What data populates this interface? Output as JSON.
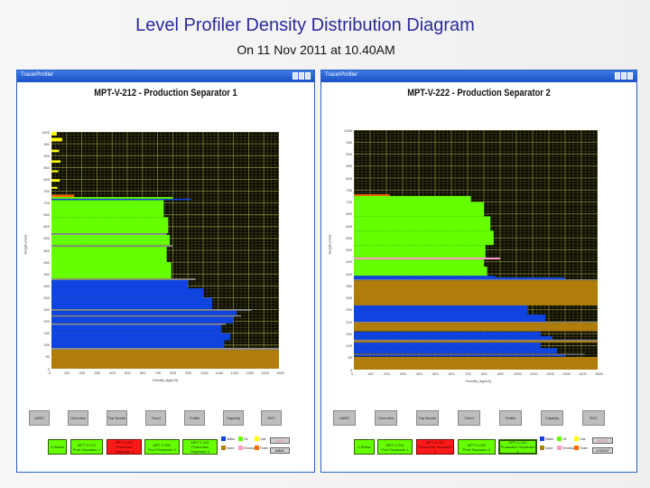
{
  "slide": {
    "title": "Level Profiler Density Distribution Diagram",
    "subtitle": "On 11 Nov 2011 at 10.40AM"
  },
  "phase_colors": {
    "water": "#1044e0",
    "oil": "#66ff00",
    "gas": "#ffff00",
    "sand": "#b07d0a",
    "emulsion": "#ff99cc",
    "foam": "#ff6a00",
    "interface": "#8c8c8c"
  },
  "windows": [
    {
      "app_title": "TracerProfiler",
      "nav_buttons": [
        "LMRC",
        "Overview",
        "Top Nozzle",
        "Trend",
        "Profile",
        "Capacity",
        "RZC"
      ],
      "vessel_buttons": [
        {
          "line1": "V-Status",
          "line2": "",
          "state": "ok"
        },
        {
          "line1": "MPT-V-212",
          "line2": "Prod Separator 1",
          "state": "ok"
        },
        {
          "line1": "MPT-V-222",
          "line2": "Production Separator 2",
          "state": "alarm"
        },
        {
          "line1": "MPT-V-232",
          "line2": "Prod Separator 3",
          "state": "ok"
        },
        {
          "line1": "MPT-V-242",
          "line2": "Production Separator 4",
          "state": "ok"
        }
      ],
      "legend": [
        "Water",
        "Oil",
        "Gas",
        "Sand",
        "Emulsion",
        "Foam"
      ],
      "alert_label": "ALERT",
      "action_label": "MIMIC"
    },
    {
      "app_title": "TracerProfiler",
      "nav_buttons": [
        "LMRC",
        "Overview",
        "Top Nozzle",
        "Trend",
        "Profile",
        "Capacity",
        "RZC"
      ],
      "vessel_buttons": [
        {
          "line1": "V-Status",
          "line2": "",
          "state": "ok"
        },
        {
          "line1": "MPT-V-212",
          "line2": "Prod Separator 1",
          "state": "ok"
        },
        {
          "line1": "MPT-V-222",
          "line2": "Production Separator 2",
          "state": "alarm"
        },
        {
          "line1": "MPT-V-232",
          "line2": "Prod Separator 3",
          "state": "ok"
        },
        {
          "line1": "MPT-V-242",
          "line2": "Production Separator 4",
          "state": "ok"
        }
      ],
      "legend": [
        "Water",
        "Oil",
        "Gas",
        "Sand",
        "Emulsion",
        "Foam"
      ],
      "alert_label": "ALERT",
      "action_label": "LOGOUT"
    }
  ],
  "chart_data": [
    {
      "type": "bar",
      "orientation": "horizontal",
      "title": "MPT-V-212 - Production Separator 1",
      "xlabel": "Density (kg/m3)",
      "ylabel": "Height (mm)",
      "xlim": [
        0,
        1500
      ],
      "ylim": [
        0,
        1000
      ],
      "xticks": [
        "0",
        "100",
        "200",
        "300",
        "400",
        "500",
        "600",
        "700",
        "800",
        "900",
        "1000",
        "1100",
        "1200",
        "1300",
        "1400",
        "1500"
      ],
      "yticks": [
        "0",
        "50",
        "100",
        "150",
        "200",
        "250",
        "300",
        "350",
        "400",
        "450",
        "500",
        "550",
        "600",
        "650",
        "700",
        "750",
        "800",
        "850",
        "900",
        "950",
        "1000"
      ],
      "grid": true,
      "bands": [
        {
          "y0": 0,
          "y1": 80,
          "phase": "sand",
          "density": 1500
        },
        {
          "y0": 80,
          "y1": 88,
          "phase": "interface",
          "density": 1500
        },
        {
          "y0": 88,
          "y1": 120,
          "phase": "water",
          "density": 1140
        },
        {
          "y0": 120,
          "y1": 150,
          "phase": "water",
          "density": 1180
        },
        {
          "y0": 150,
          "y1": 185,
          "phase": "water",
          "density": 1120
        },
        {
          "y0": 185,
          "y1": 192,
          "phase": "interface",
          "density": 1150
        },
        {
          "y0": 192,
          "y1": 220,
          "phase": "water",
          "density": 1200
        },
        {
          "y0": 220,
          "y1": 226,
          "phase": "interface",
          "density": 1250
        },
        {
          "y0": 226,
          "y1": 245,
          "phase": "water",
          "density": 1220
        },
        {
          "y0": 245,
          "y1": 252,
          "phase": "interface",
          "density": 1320
        },
        {
          "y0": 252,
          "y1": 300,
          "phase": "water",
          "density": 1060
        },
        {
          "y0": 300,
          "y1": 340,
          "phase": "water",
          "density": 1000
        },
        {
          "y0": 340,
          "y1": 374,
          "phase": "water",
          "density": 900
        },
        {
          "y0": 374,
          "y1": 381,
          "phase": "interface",
          "density": 950
        },
        {
          "y0": 381,
          "y1": 450,
          "phase": "oil",
          "density": 790
        },
        {
          "y0": 450,
          "y1": 515,
          "phase": "oil",
          "density": 760
        },
        {
          "y0": 515,
          "y1": 522,
          "phase": "interface",
          "density": 800
        },
        {
          "y0": 522,
          "y1": 565,
          "phase": "oil",
          "density": 780
        },
        {
          "y0": 565,
          "y1": 572,
          "phase": "interface",
          "density": 760
        },
        {
          "y0": 572,
          "y1": 640,
          "phase": "oil",
          "density": 770
        },
        {
          "y0": 640,
          "y1": 712,
          "phase": "oil",
          "density": 740
        },
        {
          "y0": 712,
          "y1": 718,
          "phase": "water",
          "density": 920
        },
        {
          "y0": 718,
          "y1": 725,
          "phase": "oil",
          "density": 800
        },
        {
          "y0": 725,
          "y1": 735,
          "phase": "foam",
          "density": 150
        },
        {
          "y0": 760,
          "y1": 768,
          "phase": "gas",
          "density": 40
        },
        {
          "y0": 790,
          "y1": 800,
          "phase": "gas",
          "density": 55
        },
        {
          "y0": 830,
          "y1": 838,
          "phase": "gas",
          "density": 45
        },
        {
          "y0": 870,
          "y1": 880,
          "phase": "gas",
          "density": 60
        },
        {
          "y0": 915,
          "y1": 925,
          "phase": "gas",
          "density": 50
        },
        {
          "y0": 960,
          "y1": 975,
          "phase": "gas",
          "density": 70
        },
        {
          "y0": 985,
          "y1": 1000,
          "phase": "gas",
          "density": 35
        }
      ]
    },
    {
      "type": "bar",
      "orientation": "horizontal",
      "title": "MPT-V-222 - Production Separator 2",
      "xlabel": "Density (kg/m3)",
      "ylabel": "Height (mm)",
      "xlim": [
        0,
        1500
      ],
      "ylim": [
        0,
        1000
      ],
      "xticks": [
        "0",
        "100",
        "200",
        "300",
        "400",
        "500",
        "600",
        "700",
        "800",
        "900",
        "1000",
        "1100",
        "1200",
        "1300",
        "1400",
        "1500"
      ],
      "yticks": [
        "0",
        "50",
        "100",
        "150",
        "200",
        "250",
        "300",
        "350",
        "400",
        "450",
        "500",
        "550",
        "600",
        "650",
        "700",
        "750",
        "800",
        "850",
        "900",
        "950",
        "1000"
      ],
      "grid": true,
      "bands": [
        {
          "y0": 0,
          "y1": 53,
          "phase": "sand",
          "density": 1500
        },
        {
          "y0": 55,
          "y1": 62,
          "phase": "water",
          "density": 1300
        },
        {
          "y0": 62,
          "y1": 66,
          "phase": "interface",
          "density": 1420
        },
        {
          "y0": 68,
          "y1": 90,
          "phase": "water",
          "density": 1250
        },
        {
          "y0": 90,
          "y1": 113,
          "phase": "water",
          "density": 1150
        },
        {
          "y0": 113,
          "y1": 120,
          "phase": "sand",
          "density": 1500
        },
        {
          "y0": 120,
          "y1": 125,
          "phase": "interface",
          "density": 1500
        },
        {
          "y0": 125,
          "y1": 140,
          "phase": "water",
          "density": 1220
        },
        {
          "y0": 140,
          "y1": 158,
          "phase": "water",
          "density": 1150
        },
        {
          "y0": 160,
          "y1": 196,
          "phase": "sand",
          "density": 1500
        },
        {
          "y0": 196,
          "y1": 200,
          "phase": "interface",
          "density": 1500
        },
        {
          "y0": 200,
          "y1": 230,
          "phase": "water",
          "density": 1180
        },
        {
          "y0": 230,
          "y1": 268,
          "phase": "water",
          "density": 1070
        },
        {
          "y0": 268,
          "y1": 373,
          "phase": "sand",
          "density": 1500
        },
        {
          "y0": 373,
          "y1": 377,
          "phase": "interface",
          "density": 1500
        },
        {
          "y0": 377,
          "y1": 385,
          "phase": "water",
          "density": 1300
        },
        {
          "y0": 385,
          "y1": 392,
          "phase": "water",
          "density": 870
        },
        {
          "y0": 392,
          "y1": 430,
          "phase": "oil",
          "density": 820
        },
        {
          "y0": 430,
          "y1": 460,
          "phase": "oil",
          "density": 800
        },
        {
          "y0": 460,
          "y1": 468,
          "phase": "emulsion",
          "density": 900
        },
        {
          "y0": 468,
          "y1": 520,
          "phase": "oil",
          "density": 810
        },
        {
          "y0": 520,
          "y1": 580,
          "phase": "oil",
          "density": 860
        },
        {
          "y0": 580,
          "y1": 640,
          "phase": "oil",
          "density": 840
        },
        {
          "y0": 640,
          "y1": 700,
          "phase": "oil",
          "density": 800
        },
        {
          "y0": 700,
          "y1": 725,
          "phase": "oil",
          "density": 720
        },
        {
          "y0": 725,
          "y1": 732,
          "phase": "foam",
          "density": 220
        }
      ]
    }
  ]
}
